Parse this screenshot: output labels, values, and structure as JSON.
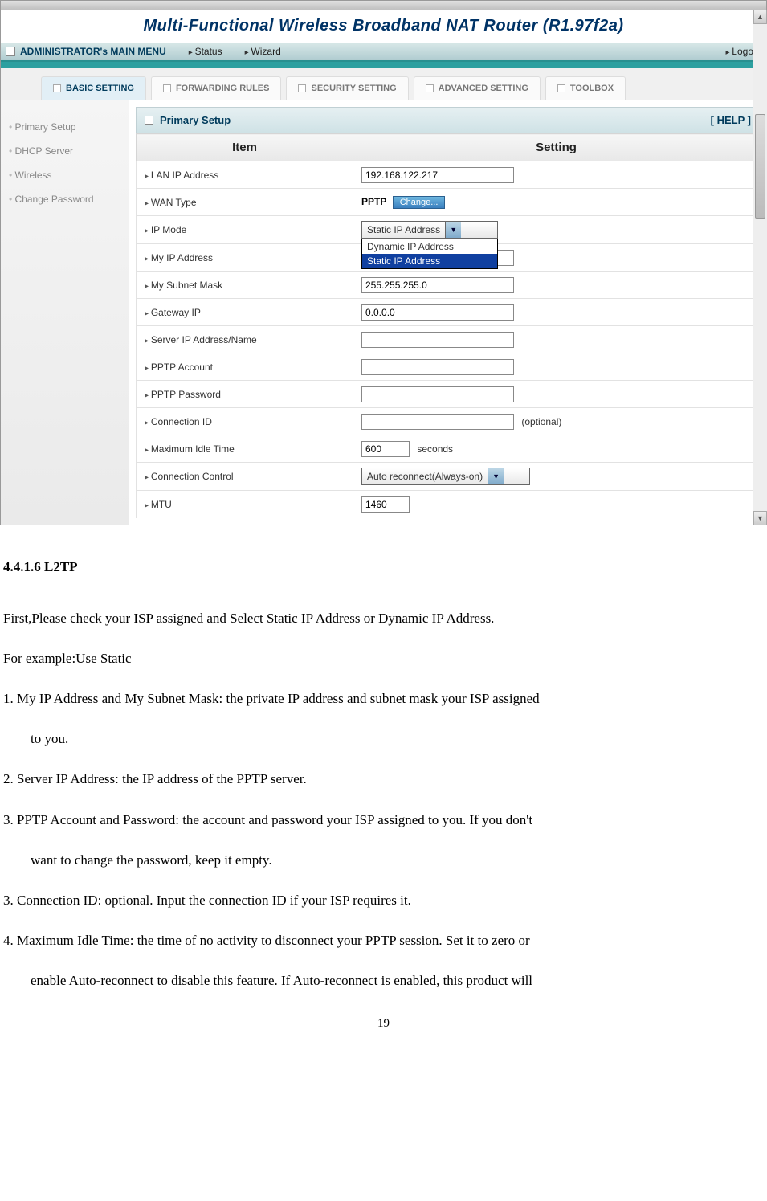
{
  "header": {
    "title": "Multi-Functional Wireless Broadband NAT Router (R1.97f2a)"
  },
  "menu": {
    "admin": "ADMINISTRATOR's MAIN MENU",
    "status": "Status",
    "wizard": "Wizard",
    "logout": "Logout"
  },
  "tabs": {
    "basic": "BASIC SETTING",
    "forwarding": "FORWARDING RULES",
    "security": "SECURITY SETTING",
    "advanced": "ADVANCED SETTING",
    "toolbox": "TOOLBOX"
  },
  "sidebar": {
    "items": [
      "Primary Setup",
      "DHCP Server",
      "Wireless",
      "Change Password"
    ]
  },
  "panel": {
    "title": "Primary Setup",
    "help": "[ HELP ]",
    "th_item": "Item",
    "th_setting": "Setting"
  },
  "rows": {
    "lan_ip": {
      "label": "LAN IP Address",
      "value": "192.168.122.217"
    },
    "wan_type": {
      "label": "WAN Type",
      "value": "PPTP",
      "btn": "Change..."
    },
    "ip_mode": {
      "label": "IP Mode",
      "selected": "Static IP Address",
      "opt_dyn": "Dynamic IP Address",
      "opt_static": "Static IP Address"
    },
    "my_ip": {
      "label": "My IP Address",
      "value": ""
    },
    "subnet": {
      "label": "My Subnet Mask",
      "value": "255.255.255.0"
    },
    "gateway": {
      "label": "Gateway IP",
      "value": "0.0.0.0"
    },
    "server_ip": {
      "label": "Server IP Address/Name",
      "value": ""
    },
    "pptp_acc": {
      "label": "PPTP Account",
      "value": ""
    },
    "pptp_pw": {
      "label": "PPTP Password",
      "value": ""
    },
    "conn_id": {
      "label": "Connection ID",
      "value": "",
      "note": "(optional)"
    },
    "idle": {
      "label": "Maximum Idle Time",
      "value": "600",
      "note": "seconds"
    },
    "conn_ctrl": {
      "label": "Connection Control",
      "selected": "Auto reconnect(Always-on)"
    },
    "mtu": {
      "label": "MTU",
      "value": "1460"
    }
  },
  "doc": {
    "heading": "4.4.1.6 L2TP",
    "p1": "First,Please check your ISP assigned and Select Static IP Address or Dynamic IP Address.",
    "p2": "For example:Use Static",
    "li1a": "1.      My IP Address and My Subnet Mask: the private IP address and subnet mask your ISP assigned",
    "li1b": "to you.",
    "li2": "2.      Server IP Address: the IP address of the PPTP server.",
    "li3a": "3.      PPTP Account and Password: the account and password your ISP assigned to you. If you don't",
    "li3b": "want to change the password, keep it empty.",
    "li4": "3.      Connection ID: optional. Input the connection ID if your ISP requires it.",
    "li5a": "4.      Maximum Idle Time: the time of no activity to disconnect your PPTP session. Set it to zero or",
    "li5b": "enable Auto-reconnect to disable this feature. If Auto-reconnect is enabled, this product will",
    "page": "19"
  }
}
